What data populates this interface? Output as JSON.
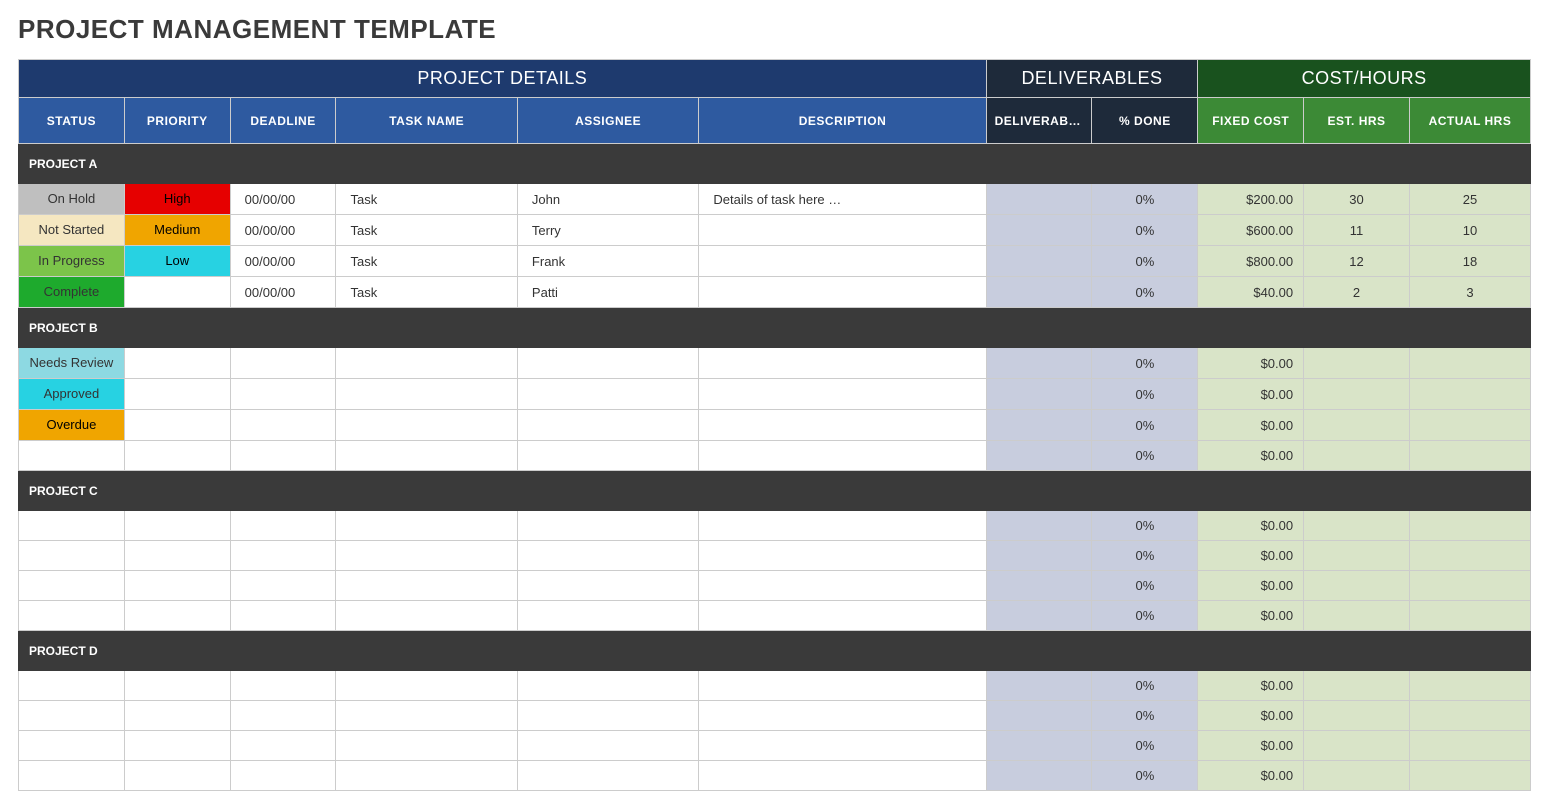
{
  "title": "PROJECT MANAGEMENT TEMPLATE",
  "section_headers": {
    "project_details": "PROJECT DETAILS",
    "deliverables": "DELIVERABLES",
    "cost_hours": "COST/HOURS"
  },
  "columns": {
    "status": "STATUS",
    "priority": "PRIORITY",
    "deadline": "DEADLINE",
    "task_name": "TASK NAME",
    "assignee": "ASSIGNEE",
    "description": "DESCRIPTION",
    "deliverable": "DELIVERABLE",
    "pct_done": "% DONE",
    "fixed_cost": "FIXED COST",
    "est_hrs": "EST. HRS",
    "actual_hrs": "ACTUAL HRS"
  },
  "status_colors": {
    "On Hold": "s-onhold",
    "Not Started": "s-notstarted",
    "In Progress": "s-inprogress",
    "Complete": "s-complete",
    "Needs Review": "s-needsreview",
    "Approved": "s-approved",
    "Overdue": "s-overdue"
  },
  "priority_colors": {
    "High": "p-high",
    "Medium": "p-medium",
    "Low": "p-low"
  },
  "groups": [
    {
      "name": "PROJECT A",
      "rows": [
        {
          "status": "On Hold",
          "priority": "High",
          "deadline": "00/00/00",
          "task": "Task",
          "assignee": "John",
          "desc": "Details of task here …",
          "deliv": "",
          "pct": "0%",
          "cost": "$200.00",
          "est": "30",
          "act": "25"
        },
        {
          "status": "Not Started",
          "priority": "Medium",
          "deadline": "00/00/00",
          "task": "Task",
          "assignee": "Terry",
          "desc": "",
          "deliv": "",
          "pct": "0%",
          "cost": "$600.00",
          "est": "11",
          "act": "10"
        },
        {
          "status": "In Progress",
          "priority": "Low",
          "deadline": "00/00/00",
          "task": "Task",
          "assignee": "Frank",
          "desc": "",
          "deliv": "",
          "pct": "0%",
          "cost": "$800.00",
          "est": "12",
          "act": "18"
        },
        {
          "status": "Complete",
          "priority": "",
          "deadline": "00/00/00",
          "task": "Task",
          "assignee": "Patti",
          "desc": "",
          "deliv": "",
          "pct": "0%",
          "cost": "$40.00",
          "est": "2",
          "act": "3"
        }
      ]
    },
    {
      "name": "PROJECT B",
      "rows": [
        {
          "status": "Needs Review",
          "priority": "",
          "deadline": "",
          "task": "",
          "assignee": "",
          "desc": "",
          "deliv": "",
          "pct": "0%",
          "cost": "$0.00",
          "est": "",
          "act": ""
        },
        {
          "status": "Approved",
          "priority": "",
          "deadline": "",
          "task": "",
          "assignee": "",
          "desc": "",
          "deliv": "",
          "pct": "0%",
          "cost": "$0.00",
          "est": "",
          "act": ""
        },
        {
          "status": "Overdue",
          "priority": "",
          "deadline": "",
          "task": "",
          "assignee": "",
          "desc": "",
          "deliv": "",
          "pct": "0%",
          "cost": "$0.00",
          "est": "",
          "act": ""
        },
        {
          "status": "",
          "priority": "",
          "deadline": "",
          "task": "",
          "assignee": "",
          "desc": "",
          "deliv": "",
          "pct": "0%",
          "cost": "$0.00",
          "est": "",
          "act": ""
        }
      ]
    },
    {
      "name": "PROJECT C",
      "rows": [
        {
          "status": "",
          "priority": "",
          "deadline": "",
          "task": "",
          "assignee": "",
          "desc": "",
          "deliv": "",
          "pct": "0%",
          "cost": "$0.00",
          "est": "",
          "act": ""
        },
        {
          "status": "",
          "priority": "",
          "deadline": "",
          "task": "",
          "assignee": "",
          "desc": "",
          "deliv": "",
          "pct": "0%",
          "cost": "$0.00",
          "est": "",
          "act": ""
        },
        {
          "status": "",
          "priority": "",
          "deadline": "",
          "task": "",
          "assignee": "",
          "desc": "",
          "deliv": "",
          "pct": "0%",
          "cost": "$0.00",
          "est": "",
          "act": ""
        },
        {
          "status": "",
          "priority": "",
          "deadline": "",
          "task": "",
          "assignee": "",
          "desc": "",
          "deliv": "",
          "pct": "0%",
          "cost": "$0.00",
          "est": "",
          "act": ""
        }
      ]
    },
    {
      "name": "PROJECT D",
      "rows": [
        {
          "status": "",
          "priority": "",
          "deadline": "",
          "task": "",
          "assignee": "",
          "desc": "",
          "deliv": "",
          "pct": "0%",
          "cost": "$0.00",
          "est": "",
          "act": ""
        },
        {
          "status": "",
          "priority": "",
          "deadline": "",
          "task": "",
          "assignee": "",
          "desc": "",
          "deliv": "",
          "pct": "0%",
          "cost": "$0.00",
          "est": "",
          "act": ""
        },
        {
          "status": "",
          "priority": "",
          "deadline": "",
          "task": "",
          "assignee": "",
          "desc": "",
          "deliv": "",
          "pct": "0%",
          "cost": "$0.00",
          "est": "",
          "act": ""
        },
        {
          "status": "",
          "priority": "",
          "deadline": "",
          "task": "",
          "assignee": "",
          "desc": "",
          "deliv": "",
          "pct": "0%",
          "cost": "$0.00",
          "est": "",
          "act": ""
        }
      ]
    }
  ]
}
